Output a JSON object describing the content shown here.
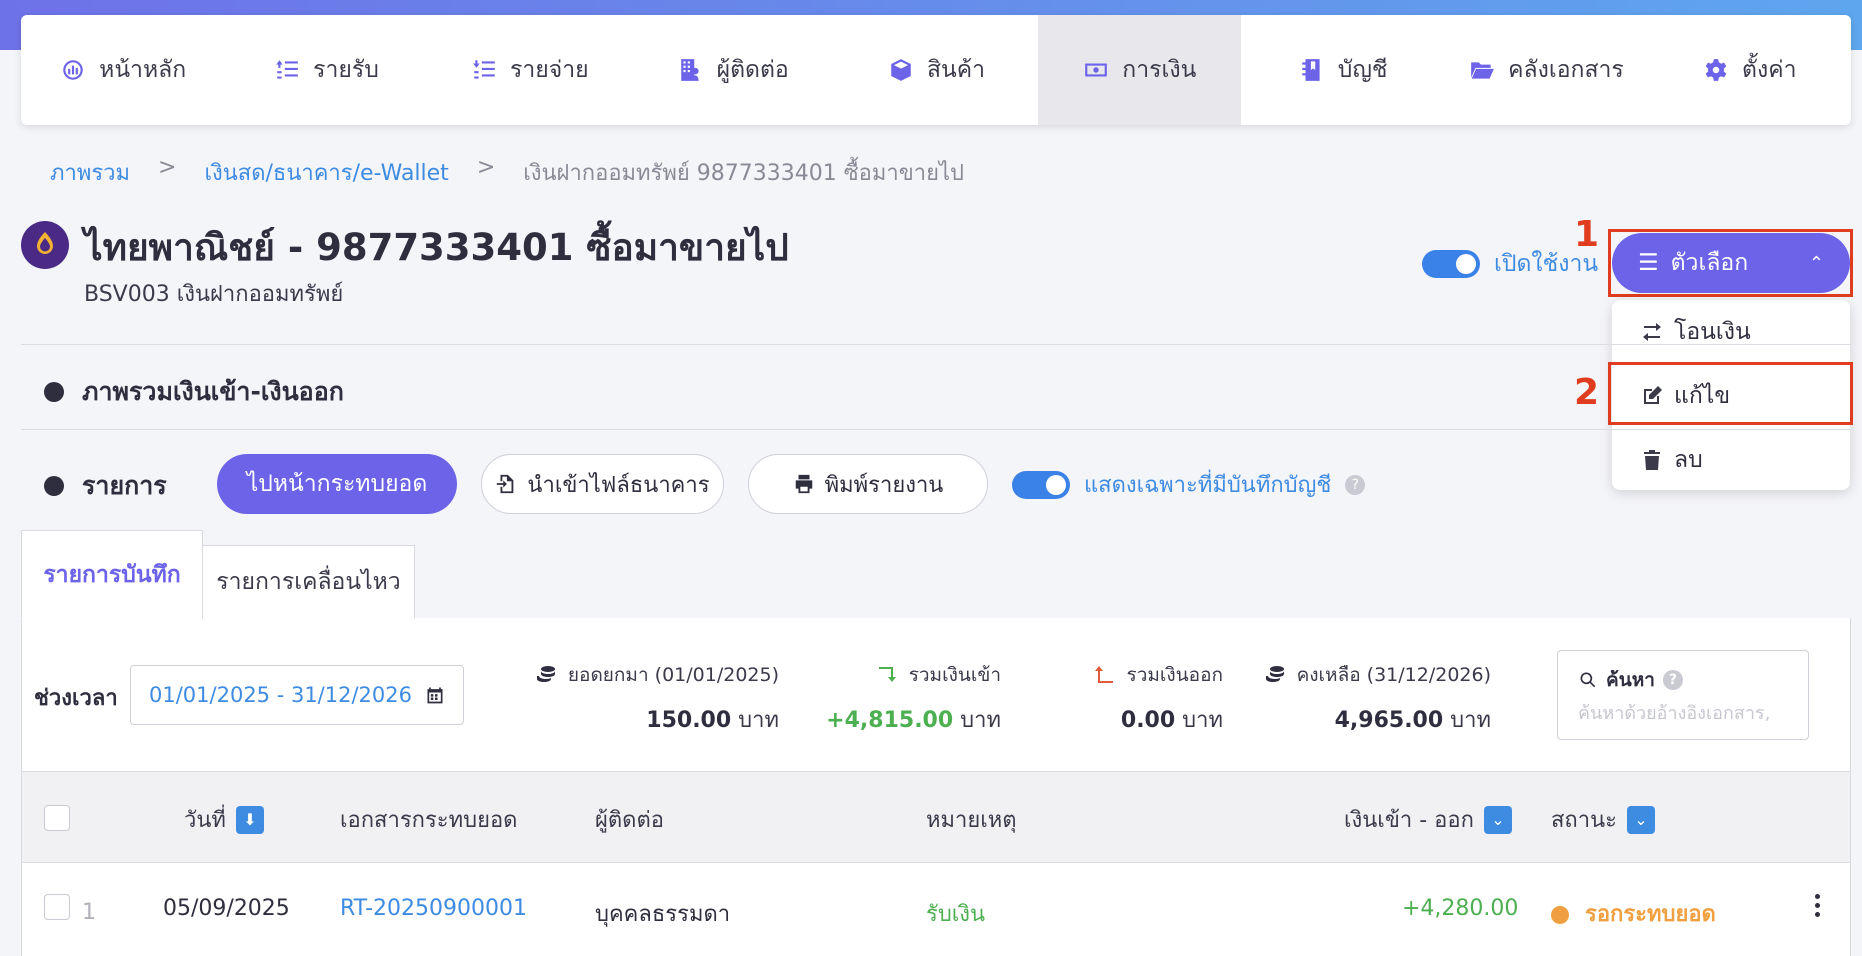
{
  "nav": {
    "items": [
      {
        "label": "หน้าหลัก",
        "icon": "dashboard-icon"
      },
      {
        "label": "รายรับ",
        "icon": "income-list-icon"
      },
      {
        "label": "รายจ่าย",
        "icon": "expense-list-icon"
      },
      {
        "label": "ผู้ติดต่อ",
        "icon": "contacts-building-icon"
      },
      {
        "label": "สินค้า",
        "icon": "box-icon"
      },
      {
        "label": "การเงิน",
        "icon": "money-icon",
        "active": true
      },
      {
        "label": "บัญชี",
        "icon": "ledger-book-icon"
      },
      {
        "label": "คลังเอกสาร",
        "icon": "folder-open-icon"
      },
      {
        "label": "ตั้งค่า",
        "icon": "gear-icon"
      }
    ]
  },
  "breadcrumb": {
    "item1": "ภาพรวม",
    "sep": ">",
    "item2": "เงินสด/ธนาคาร/e-Wallet",
    "item3": "เงินฝากออมทรัพย์ 9877333401 ซื้อมาขายไป"
  },
  "account": {
    "title": "ไทยพาณิชย์ - 9877333401 ซื้อมาขายไป",
    "subtitle": "BSV003 เงินฝากออมทรัพย์",
    "logo_icon": "scb-bank-logo",
    "enable_label": "เปิดใช้งาน"
  },
  "options": {
    "button_label": "ตัวเลือก",
    "marker1": "1",
    "marker2": "2",
    "menu": [
      {
        "label": "โอนเงิน",
        "icon": "transfer-arrows-icon"
      },
      {
        "label": "แก้ไข",
        "icon": "edit-icon"
      },
      {
        "label": "ลบ",
        "icon": "trash-icon"
      }
    ]
  },
  "sections": {
    "overview": "ภาพรวมเงินเข้า-เงินออก",
    "transactions": "รายการ"
  },
  "toolbar": {
    "reconcile_button": "ไปหน้ากระทบยอด",
    "import_button": "นำเข้าไฟล์ธนาคาร",
    "print_button": "พิมพ์รายงาน",
    "only_recorded_label": "แสดงเฉพาะที่มีบันทึกบัญชี",
    "help": "?"
  },
  "tabs": [
    "รายการบันทึก",
    "รายการเคลื่อนไหว"
  ],
  "filters": {
    "period_label": "ช่วงเวลา",
    "period_value": "01/01/2025 - 31/12/2026"
  },
  "stats": {
    "opening": {
      "label": "ยอดยกมา (01/01/2025)",
      "value": "150.00",
      "unit": "บาท"
    },
    "inflow": {
      "label": "รวมเงินเข้า",
      "value": "+4,815.00",
      "unit": "บาท"
    },
    "outflow": {
      "label": "รวมเงินออก",
      "value": "0.00",
      "unit": "บาท"
    },
    "closing": {
      "label": "คงเหลือ (31/12/2026)",
      "value": "4,965.00",
      "unit": "บาท"
    }
  },
  "search": {
    "label": "ค้นหา",
    "placeholder": "ค้นหาด้วยอ้างอิงเอกสาร,"
  },
  "table": {
    "columns": {
      "date": "วันที่",
      "doc": "เอกสารกระทบยอด",
      "contact": "ผู้ติดต่อ",
      "note": "หมายเหตุ",
      "amount": "เงินเข้า - ออก",
      "status": "สถานะ"
    },
    "rows": [
      {
        "index": "1",
        "date": "05/09/2025",
        "doc": "RT-20250900001",
        "contact": "บุคคลธรรมดา",
        "note": "รับเงิน",
        "amount": "+4,280.00",
        "status": "รอกระทบยอด"
      }
    ]
  },
  "colors": {
    "primary": "#6c63e8",
    "link": "#3e8be2",
    "highlight": "#e03c1f",
    "positive": "#4caf50",
    "pending": "#f0a040"
  }
}
